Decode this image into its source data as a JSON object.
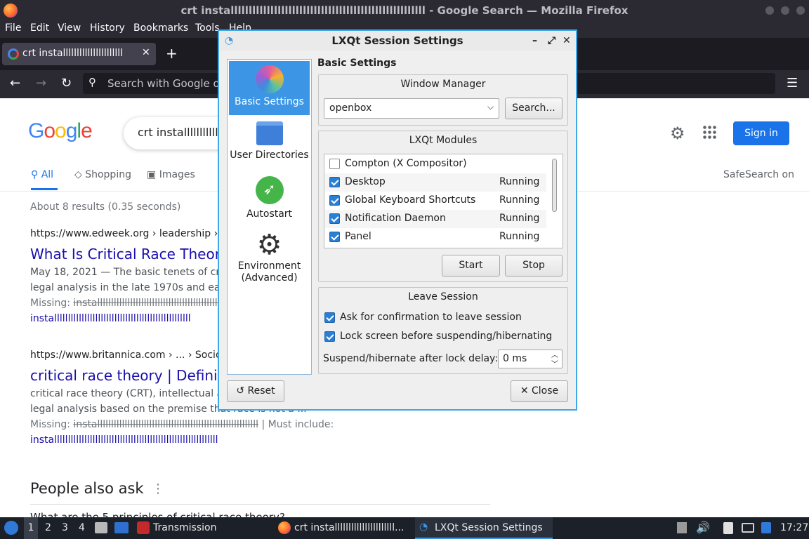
{
  "firefox": {
    "window_title": "crt installllllllllllllllllllllllllllllllllllllllllllllllllllll - Google Search — Mozilla Firefox",
    "menu": [
      "File",
      "Edit",
      "View",
      "History",
      "Bookmarks",
      "Tools",
      "Help"
    ],
    "tab_title": "crt installllllllllllllllllllll",
    "new_tab": "+",
    "url_placeholder": "Search with Google or"
  },
  "google": {
    "logo": "Google",
    "query": "crt installlllllllllll",
    "sign_in": "Sign in",
    "tabs": [
      "All",
      "Shopping",
      "Images"
    ],
    "safesearch": "SafeSearch on",
    "stats": "About 8 results (0.35 seconds)",
    "results": [
      {
        "url": "https://www.edweek.org › leadership › 2021",
        "title": "What Is Critical Race Theory, a",
        "snippet1": "May 18, 2021 — The basic tenets of critical",
        "snippet2": "legal analysis in the late 1970s and early 19",
        "missing": "Missing:",
        "missing_val": "installllllllllllllllllllllllllllllllllllllllllllllllllllllll",
        "link": "installllllllllllllllllllllllllllllllllllllllllllllllll"
      },
      {
        "url": "https://www.britannica.com › ... › Sociology",
        "title": "critical race theory | Definition,",
        "snippet1": "critical race theory (CRT), intellectual and s",
        "snippet2": "legal analysis based on the premise that race is not a ...",
        "missing": "Missing:",
        "missing_val": "installlllllllllllllllllllllllllllllllllllllllllllllllllllllllll",
        "must_include": "| Must include:",
        "link": "installllllllllllllllllllllllllllllllllllllllllllllllllllllllllll"
      }
    ],
    "people_also_ask": "People also ask",
    "paa_partial": "What are the 5 principles of critical race theory?"
  },
  "dialog": {
    "title": "LXQt Session Settings",
    "nav": [
      "Basic Settings",
      "User Directories",
      "Autostart",
      "Environment\n(Advanced)"
    ],
    "heading": "Basic Settings",
    "wm_group": "Window Manager",
    "wm_value": "openbox",
    "search_btn": "Search...",
    "modules_group": "LXQt Modules",
    "modules": [
      {
        "name": "Compton (X Compositor)",
        "status": "",
        "checked": false
      },
      {
        "name": "Desktop",
        "status": "Running",
        "checked": true
      },
      {
        "name": "Global Keyboard Shortcuts",
        "status": "Running",
        "checked": true
      },
      {
        "name": "Notification Daemon",
        "status": "Running",
        "checked": true
      },
      {
        "name": "Panel",
        "status": "Running",
        "checked": true
      }
    ],
    "start_btn": "Start",
    "stop_btn": "Stop",
    "leave_group": "Leave Session",
    "confirm_label": "Ask for confirmation to leave session",
    "lock_label": "Lock screen before suspending/hibernating",
    "delay_label": "Suspend/hibernate after lock delay:",
    "delay_value": "0 ms",
    "reset_btn": "Reset",
    "close_btn": "Close"
  },
  "taskbar": {
    "desktops": [
      "1",
      "2",
      "3",
      "4"
    ],
    "tasks": [
      "Transmission",
      "crt installllllllllllllllllllll...",
      "LXQt Session Settings"
    ],
    "clock": "17:27"
  },
  "colors": {
    "accent": "#3c96e5",
    "google_blue": "#1a73e8",
    "link": "#1a0dab"
  }
}
